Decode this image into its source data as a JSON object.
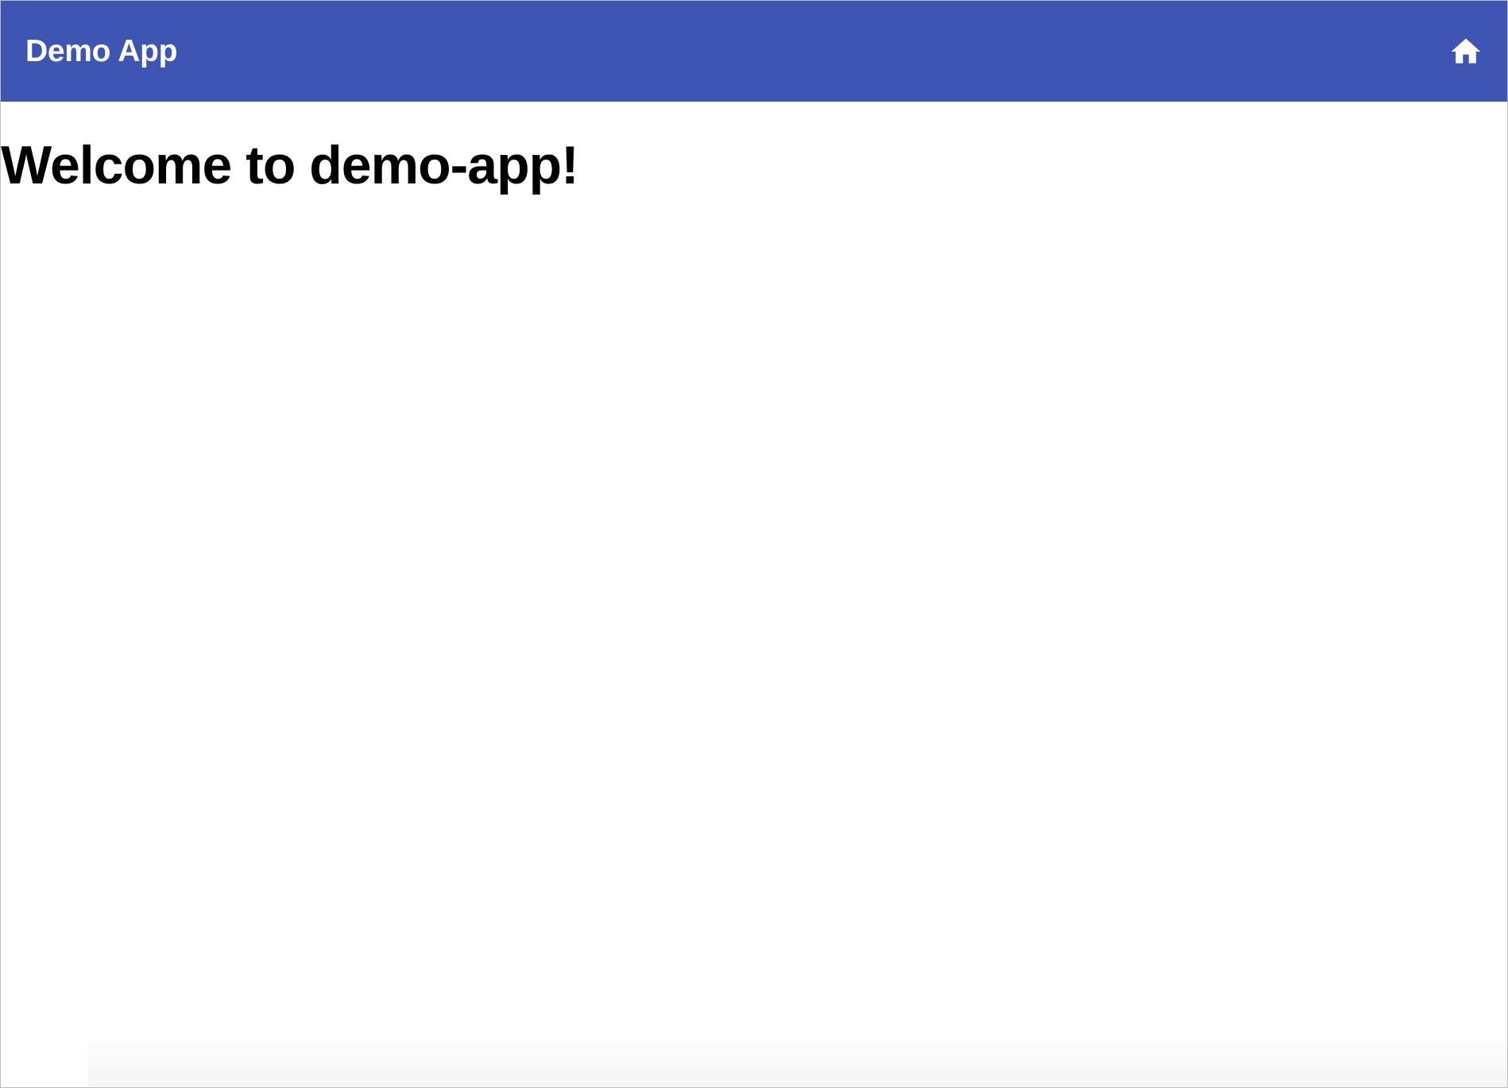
{
  "toolbar": {
    "title": "Demo App",
    "home_icon": "home-icon",
    "background_color": "#3f55b3",
    "text_color": "#ffffff"
  },
  "main": {
    "heading": "Welcome to demo-app!"
  }
}
